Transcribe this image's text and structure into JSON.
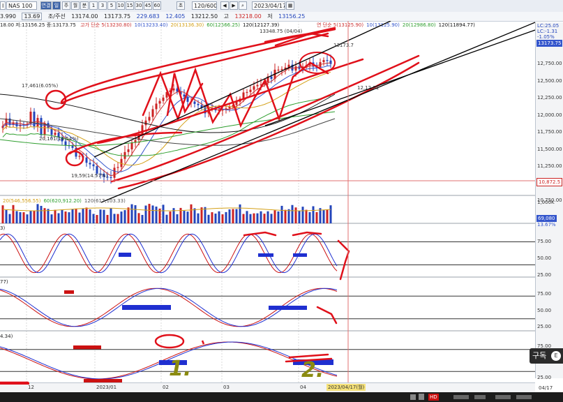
{
  "toolbar": {
    "symbol_code": "NAS 100",
    "symbol_prefix": "I",
    "tab_active": "연결",
    "tab_day": "일",
    "period_buttons": [
      "주",
      "월",
      "분",
      "1",
      "3",
      "5",
      "10",
      "15",
      "30",
      "45",
      "60"
    ],
    "extra_button": "초",
    "period_value": "120/600",
    "date_value": "2023/04/17",
    "search_hint": ""
  },
  "quote_bar": {
    "price": "3.990",
    "change": "13.69",
    "label_close": "조/주선",
    "value_a": "13174.00",
    "value_b": "13173.75",
    "value_c": "229.683",
    "value_d": "12.405",
    "value_e": "13212.50",
    "label_high": "고",
    "value_f": "13218.00",
    "label_low": "저",
    "value_g": "13156.25"
  },
  "ma_legend": {
    "prefix": "18.00 저:13156.25 종:13173.75",
    "items": [
      {
        "text": "고가 단순 5(13230.80)",
        "color": "#cc3333"
      },
      {
        "text": "10(13233.40)",
        "color": "#3355cc"
      },
      {
        "text": "20(13136.30)",
        "color": "#d4a017"
      },
      {
        "text": "60(12566.25)",
        "color": "#2e9e2e"
      },
      {
        "text": "120(12127.39)",
        "color": "#111111"
      }
    ],
    "right_items": [
      {
        "text": "연 단순 5(13125.90)",
        "color": "#cc3333"
      },
      {
        "text": "10(13125.90)",
        "color": "#3355cc"
      },
      {
        "text": "20(12986.80)",
        "color": "#2e9e2e"
      },
      {
        "text": "120(11894.77)",
        "color": "#111111"
      }
    ]
  },
  "price_annotations": {
    "high_label": "17,461(6.05%)",
    "mid_label": "20,101(14.54%)",
    "low_label": "19,59(14.57%)",
    "peak_label": "13348.75 (04/04)",
    "value_label": "13173.7",
    "extra_label": "12,12.01"
  },
  "price_axis": {
    "top_tag": "LC:25.05",
    "tag2": "LC:-1.31",
    "tag3": "-1.05%",
    "current": "13173.75",
    "ticks": [
      "12,750.00",
      "12,500.00",
      "12,250.00",
      "12,000.00",
      "11,750.00",
      "11,500.00",
      "11,250.00",
      "11,000.00",
      "10,750.00"
    ],
    "red_tag": "10,872.5"
  },
  "volume": {
    "legend": [
      {
        "text": "20(546,556.55)",
        "color": "#d4a017"
      },
      {
        "text": "60(620,912.20)",
        "color": "#2e9e2e"
      },
      {
        "text": "120(617,103.33)",
        "color": "#555555"
      }
    ],
    "axis_top": "1,000K",
    "current_tag": "69,080",
    "pct": "13.67%"
  },
  "stoch1": {
    "legend": "3)",
    "ticks": [
      "75.00",
      "50.00",
      "25.00"
    ]
  },
  "stoch2": {
    "legend": "77)",
    "ticks": [
      "75.00",
      "50.00",
      "25.00"
    ]
  },
  "stoch3": {
    "legend": "4.34)",
    "ticks": [
      "75.00",
      "25.00"
    ]
  },
  "time_axis": {
    "labels": [
      "12",
      "2023/01",
      "02",
      "03",
      "04"
    ],
    "cursor_tag": "2023/04/17(월)",
    "right_label": "04/17"
  },
  "subscribe": {
    "label": "구독",
    "dot": "E"
  },
  "status_bar": {
    "badge": "HD"
  },
  "handwriting": {
    "one": "1.",
    "two": "2."
  },
  "colors": {
    "up": "#cc2222",
    "down": "#2244bb",
    "ma5": "#cc3333",
    "ma10": "#3355cc",
    "ma20": "#d4a017",
    "ma60": "#2e9e2e",
    "ma120": "#111111",
    "annotation_red": "#e0101a",
    "annotation_olive": "#8b8b10",
    "fill_blue": "#1f2fd0",
    "fill_red": "#cc1111",
    "cursor": "#e07070"
  }
}
